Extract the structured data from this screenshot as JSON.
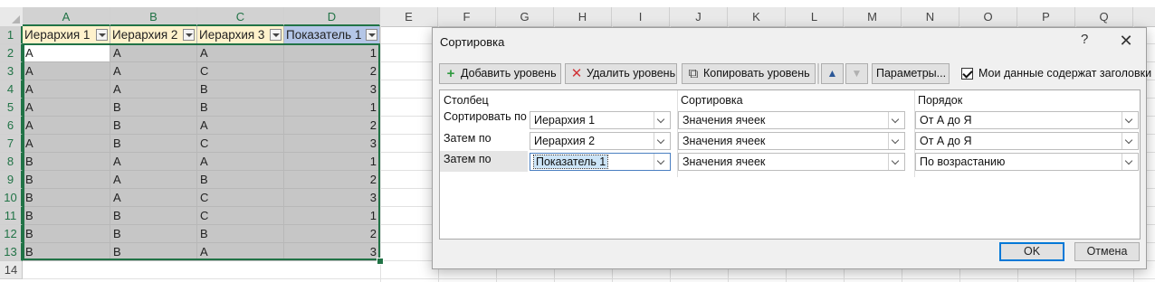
{
  "sheet": {
    "columns": [
      "A",
      "B",
      "C",
      "D",
      "E",
      "F",
      "G",
      "H",
      "I",
      "J",
      "K",
      "L",
      "M",
      "N",
      "O",
      "P",
      "Q"
    ],
    "row_numbers": [
      "1",
      "2",
      "3",
      "4",
      "5",
      "6",
      "7",
      "8",
      "9",
      "10",
      "11",
      "12",
      "13",
      "14"
    ],
    "headers": [
      "Иерархия 1",
      "Иерархия 2",
      "Иерархия 3",
      "Показатель 1"
    ],
    "rows": [
      [
        "A",
        "A",
        "A",
        "1"
      ],
      [
        "A",
        "A",
        "C",
        "2"
      ],
      [
        "A",
        "A",
        "B",
        "3"
      ],
      [
        "A",
        "B",
        "B",
        "1"
      ],
      [
        "A",
        "B",
        "A",
        "2"
      ],
      [
        "A",
        "B",
        "C",
        "3"
      ],
      [
        "B",
        "A",
        "A",
        "1"
      ],
      [
        "B",
        "A",
        "B",
        "2"
      ],
      [
        "B",
        "A",
        "C",
        "3"
      ],
      [
        "B",
        "B",
        "C",
        "1"
      ],
      [
        "B",
        "B",
        "B",
        "2"
      ],
      [
        "B",
        "B",
        "A",
        "3"
      ]
    ]
  },
  "dialog": {
    "title": "Сортировка",
    "help": "?",
    "close": "✕",
    "toolbar": {
      "add_level": "Добавить уровень",
      "delete_level": "Удалить уровень",
      "copy_level": "Копировать уровень",
      "move_up": "▲",
      "move_down": "▼",
      "options": "Параметры...",
      "headers_checkbox_label": "Мои данные содержат заголовки",
      "headers_checked": true
    },
    "grid_headers": {
      "column": "Столбец",
      "sort_on": "Сортировка",
      "order": "Порядок"
    },
    "levels": [
      {
        "label": "Сортировать по",
        "column": "Иерархия 1",
        "sort_on": "Значения ячеек",
        "order": "От А до Я"
      },
      {
        "label": "Затем по",
        "column": "Иерархия 2",
        "sort_on": "Значения ячеек",
        "order": "От А до Я"
      },
      {
        "label": "Затем по",
        "column": "Показатель 1",
        "sort_on": "Значения ячеек",
        "order": "По возрастанию"
      }
    ],
    "ok": "OK",
    "cancel": "Отмена"
  },
  "colors": {
    "excel_green": "#217346",
    "header_yellow": "#fff2cc",
    "header_blue": "#b4c6e7",
    "selection_gray": "#c6c6c6",
    "ok_border": "#0078d7"
  }
}
